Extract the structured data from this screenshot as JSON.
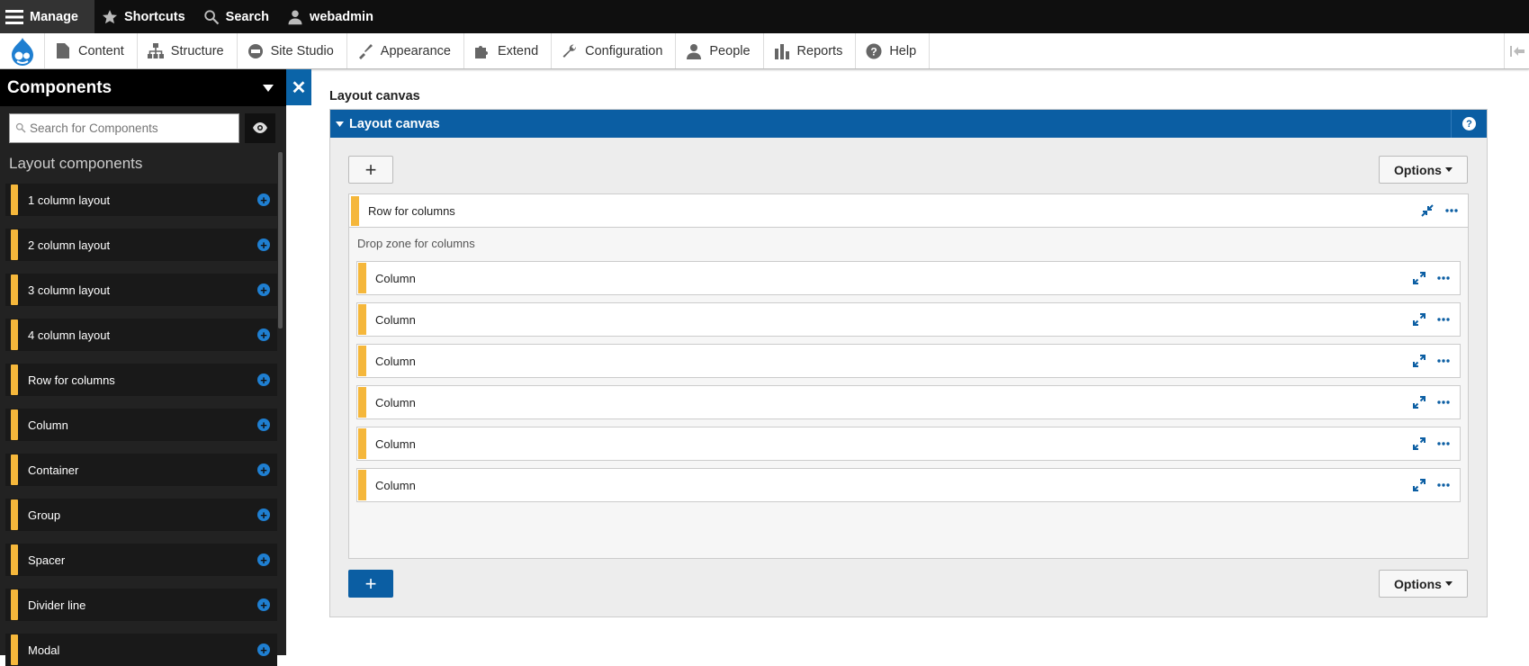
{
  "toolbar": {
    "manage": "Manage",
    "shortcuts": "Shortcuts",
    "search": "Search",
    "user": "webadmin"
  },
  "menu": {
    "items": [
      {
        "label": "Content",
        "icon": "file-icon"
      },
      {
        "label": "Structure",
        "icon": "sitemap-icon"
      },
      {
        "label": "Site Studio",
        "icon": "site-studio-icon"
      },
      {
        "label": "Appearance",
        "icon": "paintbrush-icon"
      },
      {
        "label": "Extend",
        "icon": "puzzle-icon"
      },
      {
        "label": "Configuration",
        "icon": "wrench-icon"
      },
      {
        "label": "People",
        "icon": "person-icon"
      },
      {
        "label": "Reports",
        "icon": "bar-chart-icon"
      },
      {
        "label": "Help",
        "icon": "question-icon"
      }
    ]
  },
  "sidebar": {
    "title": "Components",
    "search_placeholder": "Search for Components",
    "section": "Layout components",
    "items": [
      {
        "label": "1 column layout"
      },
      {
        "label": "2 column layout"
      },
      {
        "label": "3 column layout"
      },
      {
        "label": "4 column layout"
      },
      {
        "label": "Row for columns"
      },
      {
        "label": "Column"
      },
      {
        "label": "Container"
      },
      {
        "label": "Group"
      },
      {
        "label": "Spacer"
      },
      {
        "label": "Divider line"
      },
      {
        "label": "Modal"
      }
    ]
  },
  "main": {
    "title": "Layout canvas",
    "panel_title": "Layout canvas",
    "options_label": "Options",
    "row": {
      "label": "Row for columns",
      "drop_zone": "Drop zone for columns",
      "columns": [
        "Column",
        "Column",
        "Column",
        "Column",
        "Column",
        "Column"
      ]
    }
  },
  "colors": {
    "accent": "#0b5ea3",
    "component_bar": "#f5b73b",
    "toolbar_bg": "#0f0f0f",
    "sidebar_bg": "#222222"
  }
}
